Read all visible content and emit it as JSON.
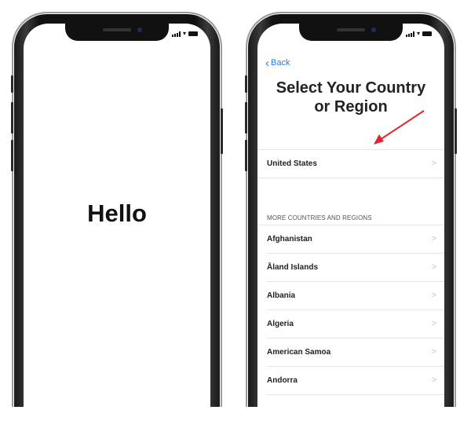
{
  "left_phone": {
    "greeting": "Hello"
  },
  "right_phone": {
    "back_label": "Back",
    "title_line1": "Select Your Country",
    "title_line2": "or Region",
    "suggested": [
      {
        "label": "United States"
      }
    ],
    "section_header": "MORE COUNTRIES AND REGIONS",
    "countries": [
      {
        "label": "Afghanistan"
      },
      {
        "label": "Åland Islands"
      },
      {
        "label": "Albania"
      },
      {
        "label": "Algeria"
      },
      {
        "label": "American Samoa"
      },
      {
        "label": "Andorra"
      }
    ],
    "row_chevron": ">"
  },
  "colors": {
    "accent": "#1f7cf1",
    "annotation_arrow": "#e0262b"
  },
  "icons": [
    "back-chevron-icon",
    "signal-icon",
    "wifi-icon",
    "battery-icon",
    "chevron-right-icon"
  ]
}
